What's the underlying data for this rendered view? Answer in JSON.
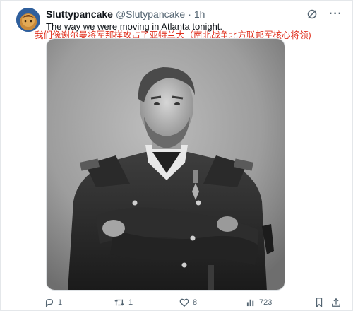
{
  "tweet": {
    "author": {
      "display_name": "Sluttypancake",
      "handle": "@Slutypancake",
      "avatar_icon": "avatar-image"
    },
    "separator": "·",
    "time": "1h",
    "text": "The way we were moving in Atlanta tonight.",
    "translation": "我们像谢尔曼将军那样攻占了亚特兰大（南北战争北方联邦军核心将领)",
    "translation_color": "#e0301e",
    "image_icon": "general-portrait-photo",
    "actions": {
      "reply_count": "1",
      "retweet_count": "1",
      "like_count": "8",
      "views_count": "723"
    },
    "icons": {
      "grok": "grok-icon",
      "more": "more-icon",
      "reply": "reply-icon",
      "retweet": "retweet-icon",
      "like": "heart-icon",
      "views": "views-icon",
      "bookmark": "bookmark-icon",
      "share": "share-icon"
    }
  }
}
